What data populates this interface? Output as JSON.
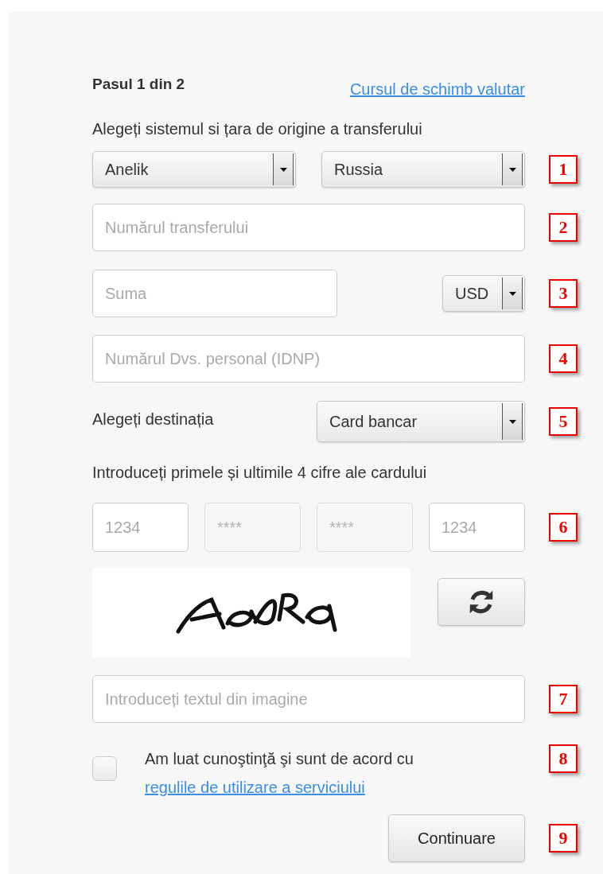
{
  "header": {
    "step": "Pasul 1 din 2",
    "exchange_rate_link": "Cursul de schimb valutar"
  },
  "rows": [
    {
      "kind": "label",
      "text": "Alegeți sistemul si țara de origine a transferului"
    },
    {
      "kind": "select_pair",
      "marker": "1",
      "selects": [
        {
          "value": "Anelik"
        },
        {
          "value": "Russia"
        }
      ]
    },
    {
      "kind": "input",
      "marker": "2",
      "placeholder": "Numărul transferului"
    },
    {
      "kind": "amount",
      "marker": "3",
      "placeholder": "Suma",
      "currency": "USD"
    },
    {
      "kind": "input",
      "marker": "4",
      "placeholder": "Numărul Dvs. personal (IDNP)"
    },
    {
      "kind": "destination",
      "marker": "5",
      "label": "Alegeți destinația",
      "value": "Card bancar"
    },
    {
      "kind": "hint",
      "text": "Introduceți primele și ultimile 4 cifre ale cardului"
    },
    {
      "kind": "card_digits",
      "marker": "6",
      "fields": [
        {
          "placeholder": "1234",
          "disabled": false
        },
        {
          "placeholder": "****",
          "disabled": true
        },
        {
          "placeholder": "****",
          "disabled": true
        },
        {
          "placeholder": "1234",
          "disabled": false
        }
      ]
    },
    {
      "kind": "captcha"
    },
    {
      "kind": "captcha_input",
      "marker": "7",
      "placeholder": "Introduceți textul din imagine"
    },
    {
      "kind": "agreement",
      "marker": "8",
      "checked": false,
      "text": "Am luat cunoştinţă şi sunt de acord cu",
      "link": "regulile de utilizare a serviciului"
    },
    {
      "kind": "submit",
      "marker": "9",
      "label": "Continuare"
    }
  ]
}
